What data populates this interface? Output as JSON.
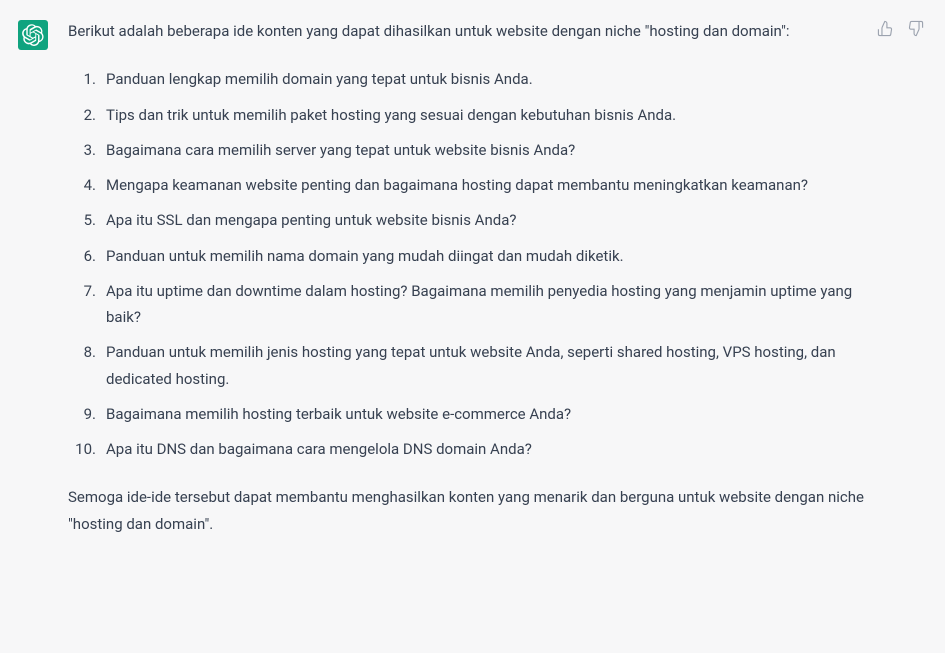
{
  "message": {
    "intro": "Berikut adalah beberapa ide konten yang dapat dihasilkan untuk website dengan niche \"hosting dan domain\":",
    "items": [
      "Panduan lengkap memilih domain yang tepat untuk bisnis Anda.",
      "Tips dan trik untuk memilih paket hosting yang sesuai dengan kebutuhan bisnis Anda.",
      "Bagaimana cara memilih server yang tepat untuk website bisnis Anda?",
      "Mengapa keamanan website penting dan bagaimana hosting dapat membantu meningkatkan keamanan?",
      "Apa itu SSL dan mengapa penting untuk website bisnis Anda?",
      "Panduan untuk memilih nama domain yang mudah diingat dan mudah diketik.",
      "Apa itu uptime dan downtime dalam hosting? Bagaimana memilih penyedia hosting yang menjamin uptime yang baik?",
      "Panduan untuk memilih jenis hosting yang tepat untuk website Anda, seperti shared hosting, VPS hosting, dan dedicated hosting.",
      "Bagaimana memilih hosting terbaik untuk website e-commerce Anda?",
      "Apa itu DNS dan bagaimana cara mengelola DNS domain Anda?"
    ],
    "outro": "Semoga ide-ide tersebut dapat membantu menghasilkan konten yang menarik dan berguna untuk website dengan niche \"hosting dan domain\"."
  },
  "icons": {
    "avatar": "assistant-logo",
    "thumbs_up": "thumbs-up-icon",
    "thumbs_down": "thumbs-down-icon"
  }
}
